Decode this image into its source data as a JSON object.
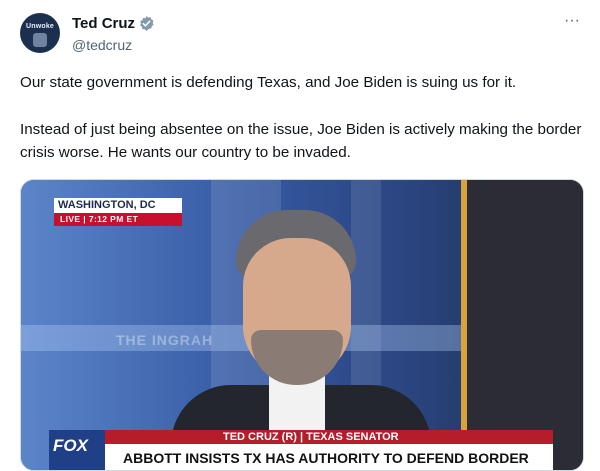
{
  "tweet": {
    "author": {
      "display_name": "Ted Cruz",
      "handle": "@tedcruz",
      "verified": true,
      "avatar_text": "Unwoke"
    },
    "more_label": "···",
    "paragraphs": [
      "Our state government is defending Texas, and Joe Biden is suing us for it.",
      "Instead of just being absentee on the issue, Joe Biden is actively making the border crisis worse. He wants our country to be invaded."
    ],
    "media": {
      "location": "WASHINGTON, DC",
      "live_label": "LIVE",
      "time": "7:12 PM ET",
      "show_name": "THE INGRAH",
      "network": "FOX",
      "name_bar": "TED CRUZ (R) | TEXAS SENATOR",
      "headline": "ABBOTT INSISTS TX HAS AUTHORITY TO DEFEND BORDER"
    }
  },
  "colors": {
    "verified": "#829aab",
    "fox_red": "#b51d2a",
    "live_red": "#c8102e",
    "fox_blue": "#1f3f86"
  }
}
